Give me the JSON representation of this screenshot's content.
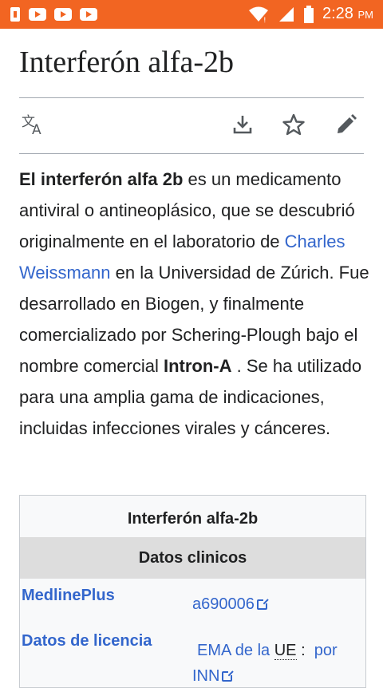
{
  "status_bar": {
    "time": "2:28",
    "ampm": "PM",
    "notification_icons": [
      "sim-icon",
      "youtube-icon",
      "youtube-icon",
      "youtube-icon"
    ],
    "system_icons": [
      "wifi-icon",
      "signal-icon",
      "battery-icon"
    ]
  },
  "page": {
    "title": "Interferón alfa-2b"
  },
  "toolbar": {
    "left": [
      "translate-icon"
    ],
    "right": [
      "download-icon",
      "star-icon",
      "edit-icon"
    ]
  },
  "article": {
    "bold_term": "El interferón alfa 2b",
    "text1": " es un medicamento antiviral o antineoplásico, que se descubrió originalmente en el laboratorio de ",
    "link_weissmann": "Charles Weissmann",
    "text2": " en la Universidad de Zúrich. Fue desarrollado en Biogen, y finalmente comercializado por Schering-Plough bajo el nombre comercial ",
    "bold_brand": "Intron-A",
    "text3": " . Se ha utilizado para una amplia gama de indicaciones, incluidas infecciones virales y cánceres."
  },
  "infobox": {
    "title": "Interferón alfa-2b",
    "section_header": "Datos clinicos",
    "rows": [
      {
        "label": "MedlinePlus",
        "value": "a690006"
      },
      {
        "label": "Datos de licencia",
        "value_prefix": "EMA de la ",
        "value_abbr": "UE",
        "value_sep": ":",
        "value_link1": "por",
        "value_link2": "INN"
      }
    ]
  }
}
